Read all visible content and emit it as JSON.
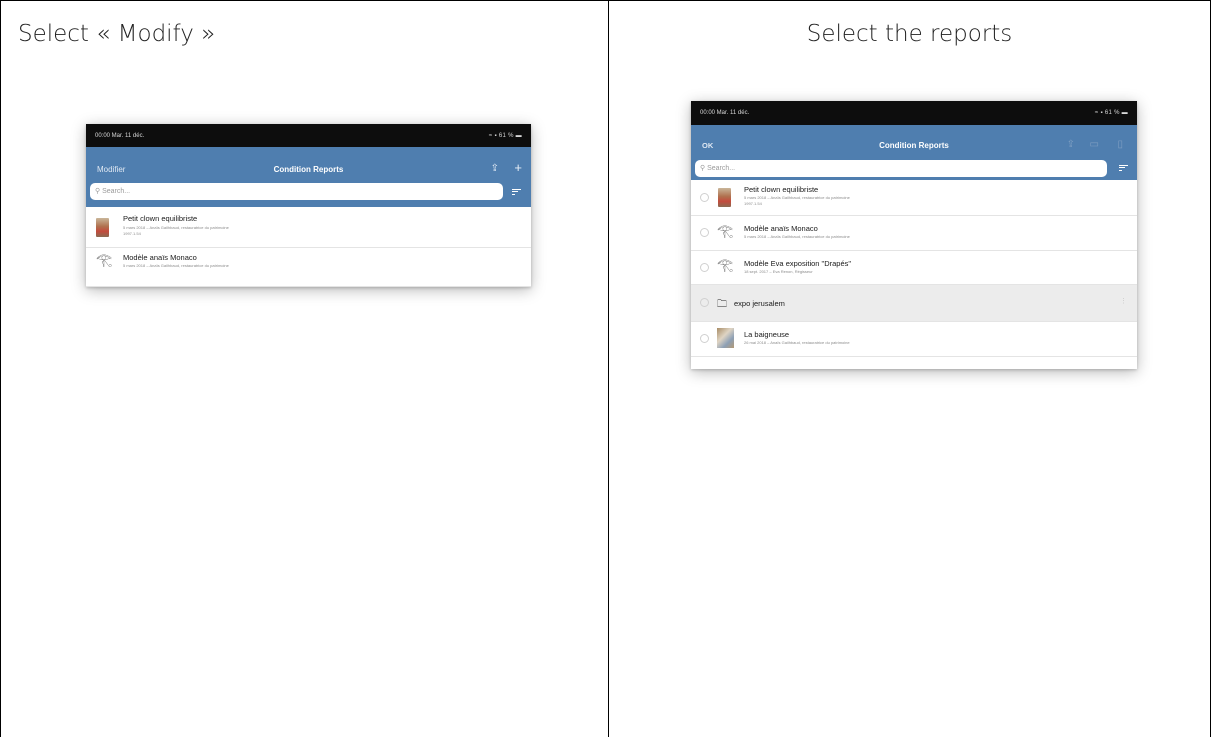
{
  "left": {
    "caption": "Select « Modify »",
    "phone": {
      "status_time": "00:00  Mar. 11 déc.",
      "status_right": "≈ ▪ 61 % ▬",
      "nav_left": "Modifier",
      "nav_title": "Condition Reports",
      "share_icon": "share-icon",
      "add_icon": "plus-icon",
      "search_placeholder": "Search...",
      "rows": [
        {
          "title": "Petit clown equilibriste",
          "sub1": "5 mars 2018 – Anaïs Gailhbaud, restauratrice du patrimoine",
          "sub2": "1997.1.54",
          "thumb": "clown"
        },
        {
          "title": "Modèle anaïs Monaco",
          "sub1": "5 mars 2018 – Anaïs Gailhbaud, restauratrice du patrimoine",
          "sub2": "",
          "thumb": "eye"
        }
      ]
    }
  },
  "right": {
    "caption": "Select the reports",
    "phone": {
      "status_time": "00:00  Mar. 11 déc.",
      "status_right": "≈ ▪ 61 % ▬",
      "nav_left": "OK",
      "nav_title": "Condition Reports",
      "search_placeholder": "Search...",
      "rows": [
        {
          "title": "Petit clown equilibriste",
          "sub1": "5 mars 2018 – Anaïs Gailhbaud, restauratrice du patrimoine",
          "sub2": "1997.1.54",
          "thumb": "clown"
        },
        {
          "title": "Modèle anaïs Monaco",
          "sub1": "5 mars 2018 – Anaïs Gailhbaud, restauratrice du patrimoine",
          "sub2": "",
          "thumb": "eye"
        },
        {
          "title": "Modèle Eva exposition \"Drapés\"",
          "sub1": "18 sept. 2017 – Eva Renon, Régisseur",
          "sub2": "",
          "thumb": "eye"
        },
        {
          "title": "expo jerusalem",
          "sub1": "",
          "sub2": "",
          "thumb": "folder"
        },
        {
          "title": "La baigneuse",
          "sub1": "26 mai 2018 – Anaïs Gailhbaud, restauratrice du patrimoine",
          "sub2": "",
          "thumb": "photo"
        }
      ]
    }
  }
}
